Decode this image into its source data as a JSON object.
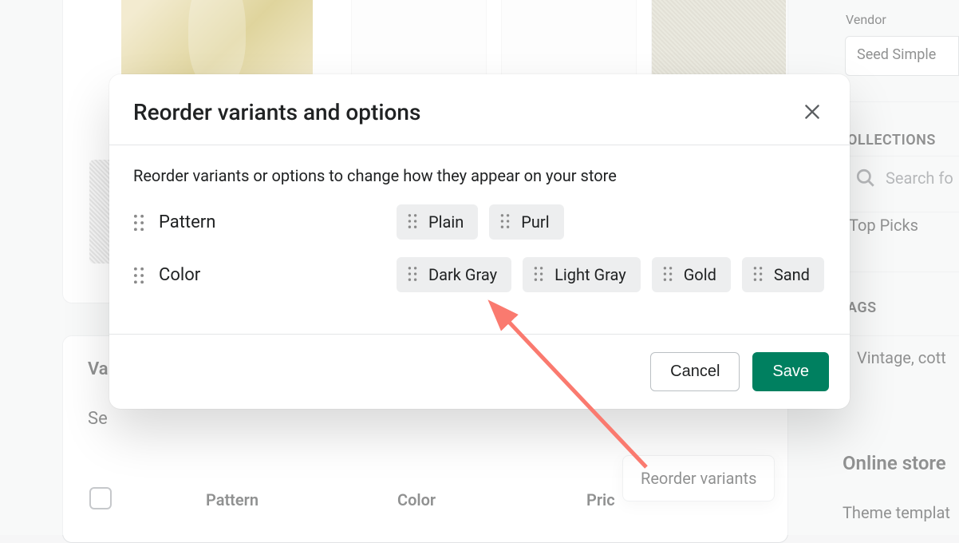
{
  "modal": {
    "title": "Reorder variants and options",
    "description": "Reorder variants or options to change how they appear on your store",
    "options": [
      {
        "name": "Pattern",
        "values": [
          "Plain",
          "Purl"
        ]
      },
      {
        "name": "Color",
        "values": [
          "Dark Gray",
          "Light Gray",
          "Gold",
          "Sand"
        ]
      }
    ],
    "cancel_label": "Cancel",
    "save_label": "Save"
  },
  "popover": {
    "reorder_variants": "Reorder variants"
  },
  "sidebar": {
    "vendor_label": "Vendor",
    "vendor_value": "Seed Simple",
    "collections_label": "OLLECTIONS",
    "search_placeholder": "Search fo",
    "top_picks": "Top Picks",
    "tags_label": "AGS",
    "tags_value": "Vintage, cott",
    "online_store": "Online store",
    "theme_template": "Theme templat"
  },
  "background": {
    "variants_title_partial": "Va",
    "select_partial": "Se",
    "columns": {
      "pattern": "Pattern",
      "color": "Color",
      "price": "Pric"
    }
  }
}
